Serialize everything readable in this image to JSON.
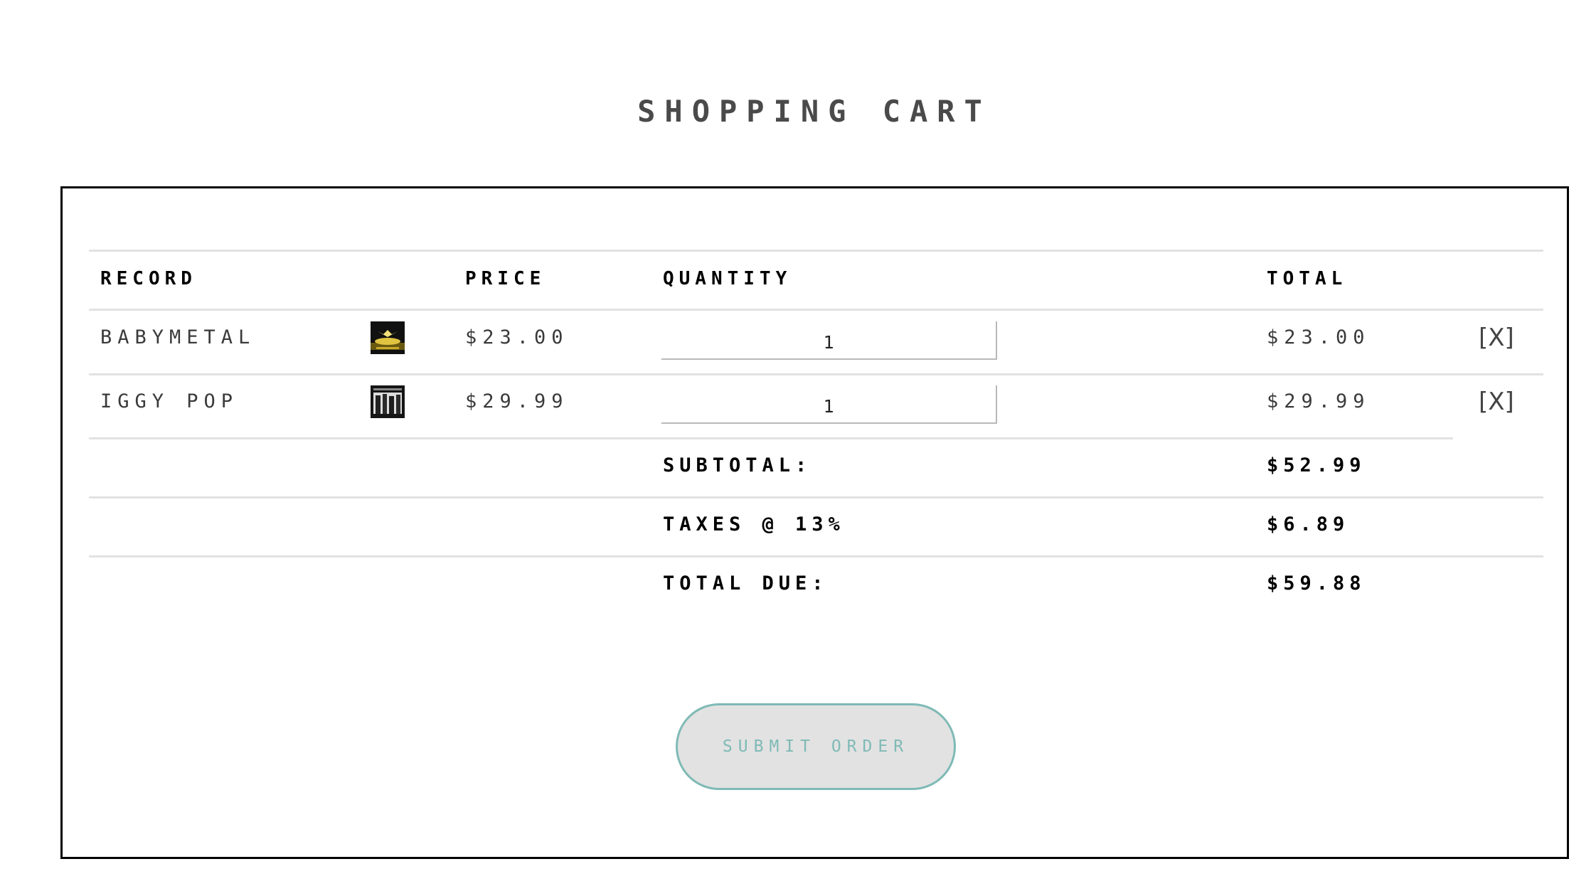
{
  "page": {
    "title": "SHOPPING CART"
  },
  "table": {
    "headers": {
      "record": "RECORD",
      "price": "PRICE",
      "quantity": "QUANTITY",
      "total": "TOTAL"
    },
    "rows": [
      {
        "record": "BABYMETAL",
        "cover_icon": "babymetal-album-cover",
        "price": "$23.00",
        "quantity": "1",
        "total": "$23.00",
        "remove_label": "[X]"
      },
      {
        "record": "IGGY POP",
        "cover_icon": "iggy-pop-album-cover",
        "price": "$29.99",
        "quantity": "1",
        "total": "$29.99",
        "remove_label": "[X]"
      }
    ]
  },
  "summary": {
    "subtotal_label": "SUBTOTAL:",
    "subtotal_value": "$52.99",
    "taxes_label": "TAXES @ 13%",
    "taxes_value": "$6.89",
    "total_due_label": "TOTAL DUE:",
    "total_due_value": "$59.88"
  },
  "actions": {
    "submit_label": "SUBMIT ORDER"
  },
  "colors": {
    "title": "#4a4a4a",
    "border": "#000000",
    "divider": "#e2e2e2",
    "button_accent": "#7fbab6",
    "button_bg": "#e2e2e2"
  }
}
